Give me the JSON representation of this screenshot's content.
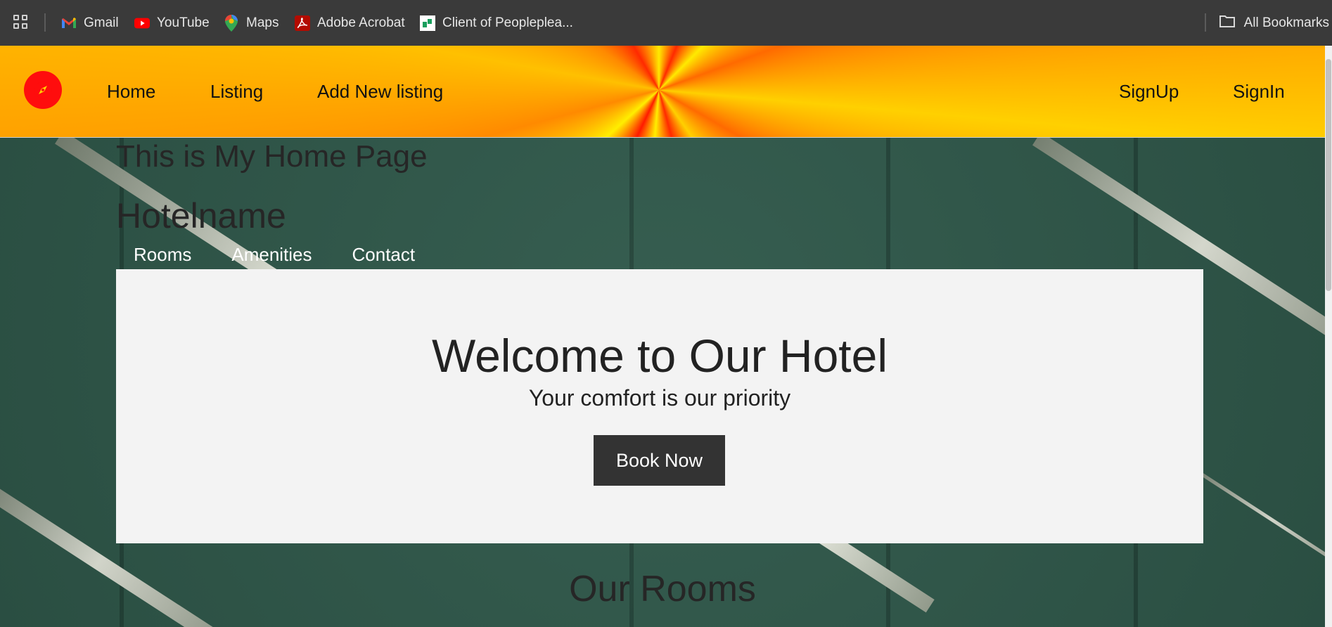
{
  "bookmarks": {
    "items": [
      {
        "label": "Gmail",
        "icon": "gmail-icon"
      },
      {
        "label": "YouTube",
        "icon": "youtube-icon"
      },
      {
        "label": "Maps",
        "icon": "maps-icon"
      },
      {
        "label": "Adobe Acrobat",
        "icon": "acrobat-icon"
      },
      {
        "label": "Client of Peopleplea...",
        "icon": "site-favicon-icon"
      }
    ],
    "all_bookmarks": "All Bookmarks"
  },
  "navbar": {
    "links": [
      "Home",
      "Listing",
      "Add New listing"
    ],
    "signup": "SignUp",
    "signin": "SignIn",
    "logo_color": "#ff0d0d"
  },
  "page": {
    "title": "This is My Home Page",
    "hotel_name": "Hotelname",
    "subnav": [
      "Rooms",
      "Amenities",
      "Contact"
    ]
  },
  "hero": {
    "title": "Welcome to Our Hotel",
    "subtitle": "Your comfort is our priority",
    "button": "Book Now"
  },
  "rooms": {
    "title": "Our Rooms"
  }
}
